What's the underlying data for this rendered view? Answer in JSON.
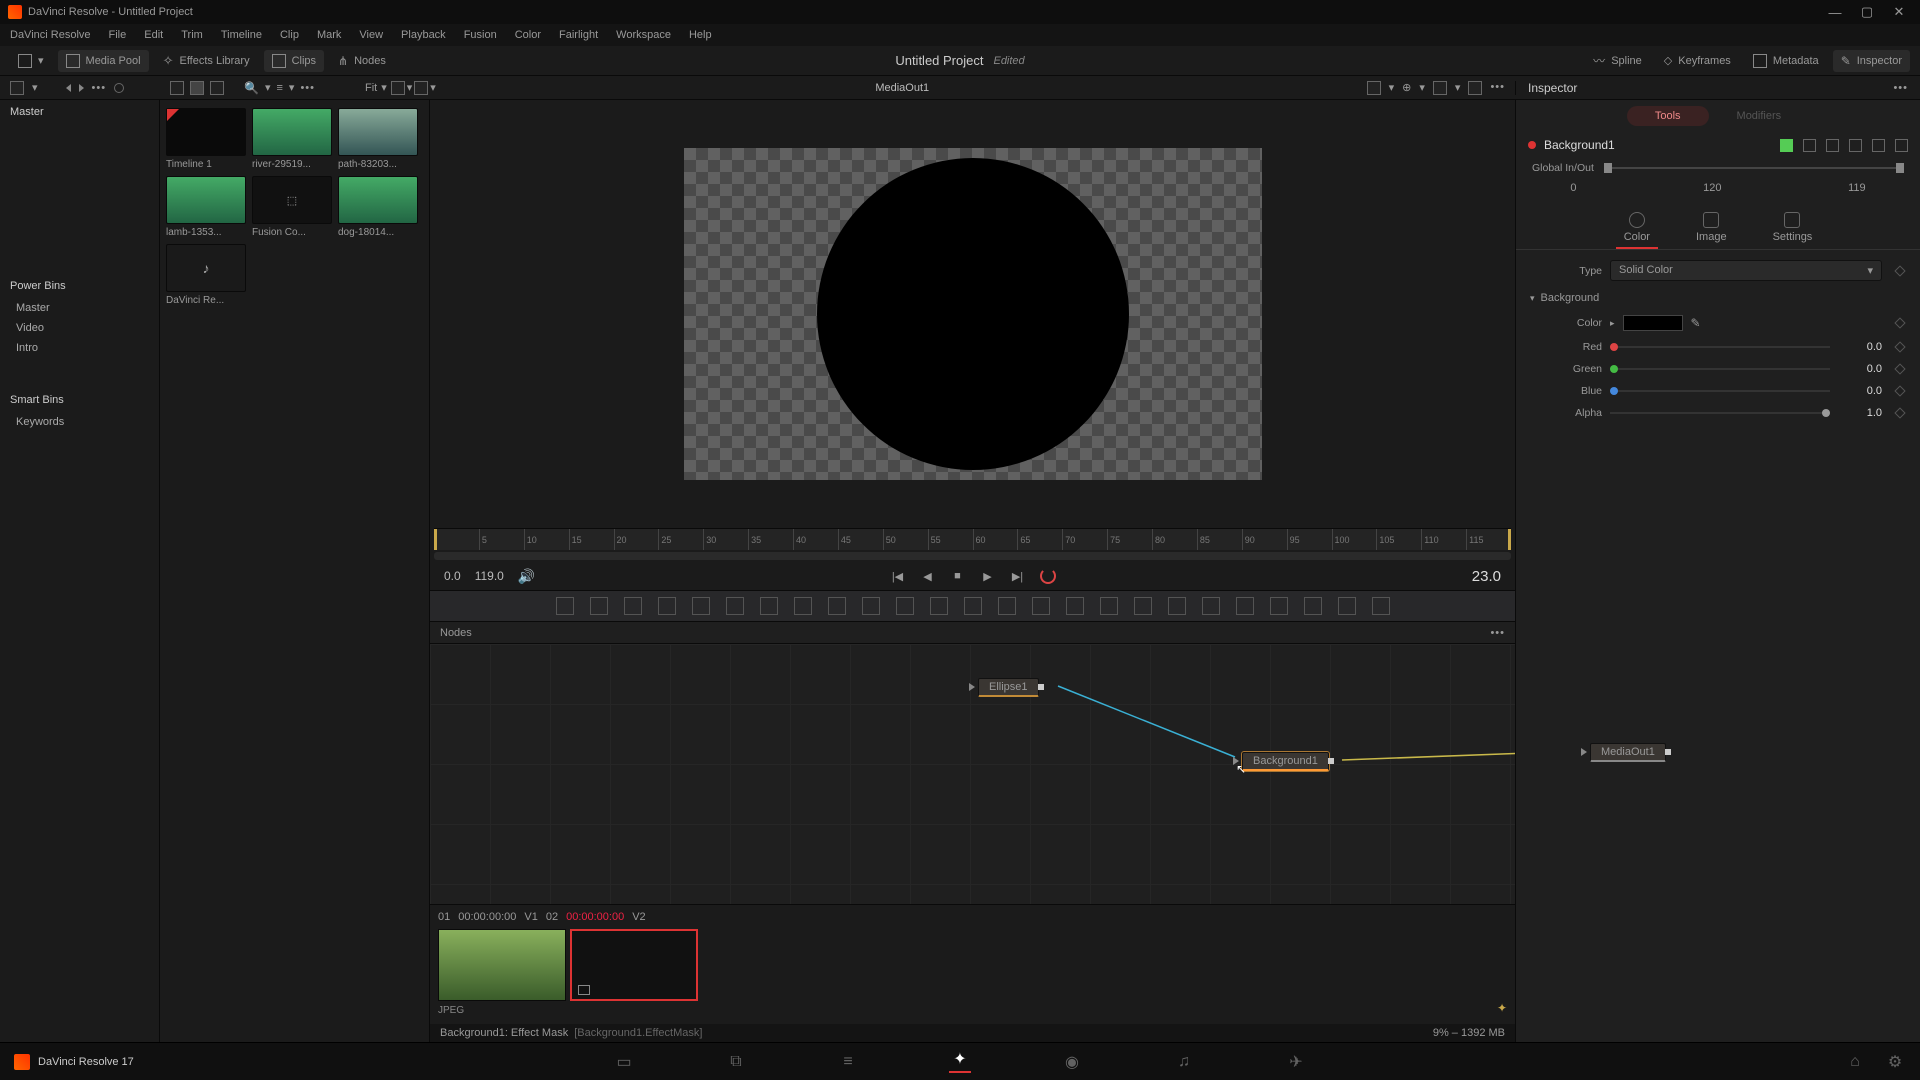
{
  "titlebar": {
    "title": "DaVinci Resolve - Untitled Project"
  },
  "menubar": [
    "DaVinci Resolve",
    "File",
    "Edit",
    "Trim",
    "Timeline",
    "Clip",
    "Mark",
    "View",
    "Playback",
    "Fusion",
    "Color",
    "Fairlight",
    "Workspace",
    "Help"
  ],
  "toolbar": {
    "mediaPool": "Media Pool",
    "effects": "Effects Library",
    "clips": "Clips",
    "nodes": "Nodes",
    "spline": "Spline",
    "keyframes": "Keyframes",
    "metadata": "Metadata",
    "inspector": "Inspector"
  },
  "projectTitle": "Untitled Project",
  "projectEdited": "Edited",
  "subbar": {
    "fit": "Fit",
    "viewerTitle": "MediaOut1",
    "inspector": "Inspector",
    "dots": "•••"
  },
  "mediaPool": {
    "master": "Master",
    "powerBins": "Power Bins",
    "bins": [
      "Master",
      "Video",
      "Intro"
    ],
    "smartBins": "Smart Bins",
    "keywords": "Keywords",
    "clips": [
      {
        "label": "Timeline 1",
        "cls": "t1"
      },
      {
        "label": "river-29519...",
        "cls": "nature"
      },
      {
        "label": "path-83203...",
        "cls": "path"
      },
      {
        "label": "lamb-1353...",
        "cls": "nature"
      },
      {
        "label": "Fusion Co...",
        "cls": "black",
        "glyph": "⬚"
      },
      {
        "label": "dog-18014...",
        "cls": "nature"
      },
      {
        "label": "DaVinci Re...",
        "cls": "audio",
        "glyph": "♪"
      }
    ]
  },
  "ruler": [
    "5",
    "10",
    "15",
    "20",
    "25",
    "30",
    "35",
    "40",
    "45",
    "50",
    "55",
    "60",
    "65",
    "70",
    "75",
    "80",
    "85",
    "90",
    "95",
    "100",
    "105",
    "110",
    "115"
  ],
  "transport": {
    "in": "0.0",
    "out": "119.0",
    "current": "23.0"
  },
  "nodesPanel": {
    "title": "Nodes",
    "nodes": {
      "ellipse": "Ellipse1",
      "background": "Background1",
      "mediaout": "MediaOut1"
    }
  },
  "clipStrip": {
    "hdr": {
      "a": "01",
      "atc": "00:00:00:00",
      "av": "V1",
      "b": "02",
      "btc": "00:00:00:00",
      "bv": "V2"
    },
    "format": "JPEG"
  },
  "status": {
    "main": "Background1: Effect Mask",
    "bracket": "[Background1.EffectMask]",
    "right": "9% – 1392 MB"
  },
  "pagebar": {
    "app": "DaVinci Resolve 17"
  },
  "inspector": {
    "tabs": {
      "tools": "Tools",
      "modifiers": "Modifiers"
    },
    "nodeName": "Background1",
    "globalLabel": "Global In/Out",
    "globalVals": {
      "in": "0",
      "mid": "120",
      "out": "119"
    },
    "pageTabs": {
      "color": "Color",
      "image": "Image",
      "settings": "Settings"
    },
    "typeLabel": "Type",
    "typeVal": "Solid Color",
    "sectionBg": "Background",
    "colorLabel": "Color",
    "channels": [
      {
        "lbl": "Red",
        "val": "0.0",
        "dot": "red",
        "pos": "left"
      },
      {
        "lbl": "Green",
        "val": "0.0",
        "dot": "green",
        "pos": "left"
      },
      {
        "lbl": "Blue",
        "val": "0.0",
        "dot": "blue",
        "pos": "left"
      },
      {
        "lbl": "Alpha",
        "val": "1.0",
        "dot": "grey",
        "pos": "right"
      }
    ]
  }
}
